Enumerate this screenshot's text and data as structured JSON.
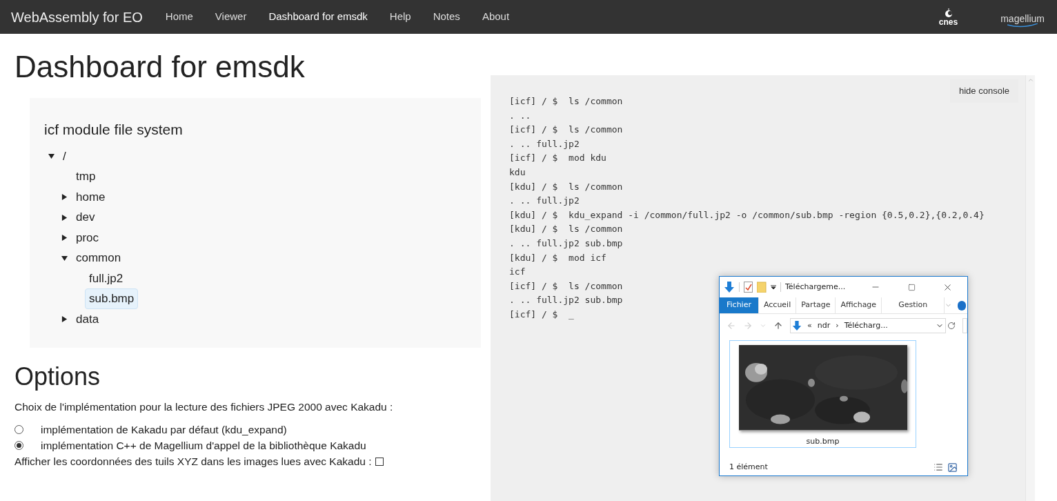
{
  "navbar": {
    "brand": "WebAssembly for EO",
    "links": [
      {
        "label": "Home",
        "selected": false
      },
      {
        "label": "Viewer",
        "selected": false
      },
      {
        "label": "Dashboard for emsdk",
        "selected": true
      },
      {
        "label": "Help",
        "selected": false
      },
      {
        "label": "Notes",
        "selected": false
      },
      {
        "label": "About",
        "selected": false
      }
    ],
    "logos": [
      "cnes",
      "magellium"
    ]
  },
  "page_title": "Dashboard for emsdk",
  "file_system": {
    "title": "icf module file system",
    "tree": [
      {
        "label": "/",
        "kind": "folder",
        "expanded": true,
        "selected": false,
        "children": [
          {
            "label": "tmp",
            "kind": "leaf",
            "selected": false
          },
          {
            "label": "home",
            "kind": "folder",
            "expanded": false,
            "selected": false
          },
          {
            "label": "dev",
            "kind": "folder",
            "expanded": false,
            "selected": false
          },
          {
            "label": "proc",
            "kind": "folder",
            "expanded": false,
            "selected": false
          },
          {
            "label": "common",
            "kind": "folder",
            "expanded": true,
            "selected": false,
            "children": [
              {
                "label": "full.jp2",
                "kind": "leaf",
                "selected": false
              },
              {
                "label": "sub.bmp",
                "kind": "leaf",
                "selected": true
              }
            ]
          },
          {
            "label": "data",
            "kind": "folder",
            "expanded": false,
            "selected": false
          }
        ]
      }
    ]
  },
  "options": {
    "title": "Options",
    "prompt": "Choix de l'implémentation pour la lecture des fichiers JPEG 2000 avec Kakadu :",
    "radios": [
      {
        "label": "implémentation de Kakadu par défaut (kdu_expand)",
        "selected": false
      },
      {
        "label": "implémentation C++ de Magellium d'appel de la bibliothèque Kakadu",
        "selected": true
      }
    ],
    "checkbox": {
      "label": "Afficher les coordonnées des tuils XYZ dans les images lues avec Kakadu :",
      "checked": false
    }
  },
  "console": {
    "hide_button": "hide console",
    "lines": [
      {
        "kind": "command",
        "prompt": "[icf] / $",
        "command": "ls /common"
      },
      {
        "kind": "output",
        "text": ". .."
      },
      {
        "kind": "command",
        "prompt": "[icf] / $",
        "command": "ls /common"
      },
      {
        "kind": "output",
        "text": ". .. full.jp2"
      },
      {
        "kind": "command",
        "prompt": "[icf] / $",
        "command": "mod kdu"
      },
      {
        "kind": "output",
        "text": "kdu"
      },
      {
        "kind": "command",
        "prompt": "[kdu] / $",
        "command": "ls /common"
      },
      {
        "kind": "output",
        "text": ". .. full.jp2"
      },
      {
        "kind": "command",
        "prompt": "[kdu] / $",
        "command": "kdu_expand -i /common/full.jp2 -o /common/sub.bmp -region {0.5,0.2},{0.2,0.4}"
      },
      {
        "kind": "command",
        "prompt": "[kdu] / $",
        "command": "ls /common"
      },
      {
        "kind": "output",
        "text": ". .. full.jp2 sub.bmp"
      },
      {
        "kind": "command",
        "prompt": "[kdu] / $",
        "command": "mod icf"
      },
      {
        "kind": "output",
        "text": "icf"
      },
      {
        "kind": "command",
        "prompt": "[icf] / $",
        "command": "ls /common"
      },
      {
        "kind": "output",
        "text": ". .. full.jp2 sub.bmp"
      },
      {
        "kind": "command",
        "prompt": "[icf] / $",
        "command": "_"
      }
    ]
  },
  "explorer": {
    "title": "Téléchargeme...",
    "ribbon_tabs": [
      {
        "label": "Fichier",
        "selected": true
      },
      {
        "label": "Accueil",
        "selected": false
      },
      {
        "label": "Partage",
        "selected": false
      },
      {
        "label": "Affichage",
        "selected": false
      },
      {
        "label": "Gestion",
        "selected": false
      }
    ],
    "breadcrumb": [
      "«",
      "ndr",
      "›",
      "Télécharg..."
    ],
    "files": [
      {
        "name": "sub.bmp",
        "kind": "picture",
        "selected": true
      }
    ],
    "status": "1 élément"
  }
}
